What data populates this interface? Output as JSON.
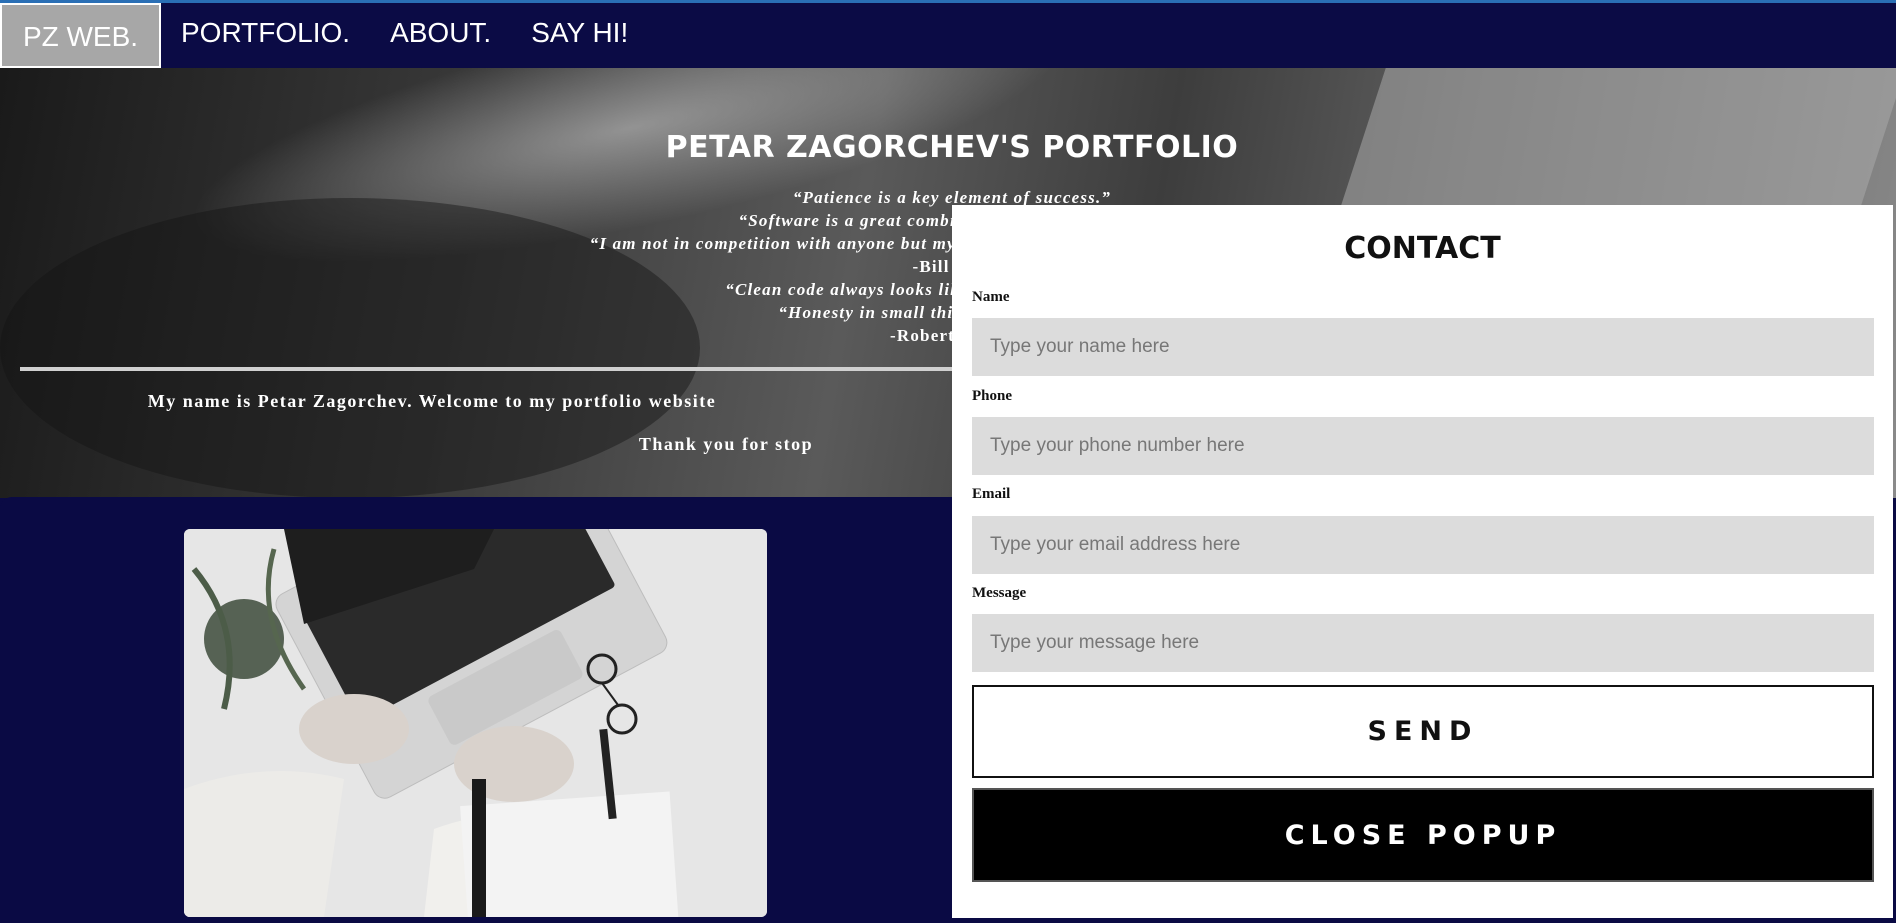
{
  "nav": {
    "brand": "PZ WEB.",
    "items": [
      {
        "label": "PORTFOLIO."
      },
      {
        "label": "ABOUT."
      },
      {
        "label": "SAY HI!"
      }
    ]
  },
  "hero": {
    "title": "PETAR ZAGORCHEV'S PORTFOLIO",
    "quotes": [
      "“Patience is a key element of success.”",
      "“Software is a great combination b",
      "“I am not in competition with anyone but myse",
      "-Bill G",
      "“Clean code always looks like it wa",
      "“Honesty in small thing",
      "-Robert C"
    ],
    "welcome": "My name is Petar Zagorchev. Welcome to my portfolio website",
    "thanks": "Thank you for stop"
  },
  "contact": {
    "title": "CONTACT",
    "fields": [
      {
        "label": "Name",
        "placeholder": "Type your name here"
      },
      {
        "label": "Phone",
        "placeholder": "Type your phone number here"
      },
      {
        "label": "Email",
        "placeholder": "Type your email address here"
      },
      {
        "label": "Message",
        "placeholder": "Type your message here"
      }
    ],
    "send_label": "SEND",
    "close_label": "CLOSE POPUP"
  },
  "colors": {
    "nav_bg": "#0b0b45",
    "page_bg": "#0a0a44",
    "input_bg": "#dcdcdc",
    "active_nav_bg": "#a7a7a7"
  }
}
